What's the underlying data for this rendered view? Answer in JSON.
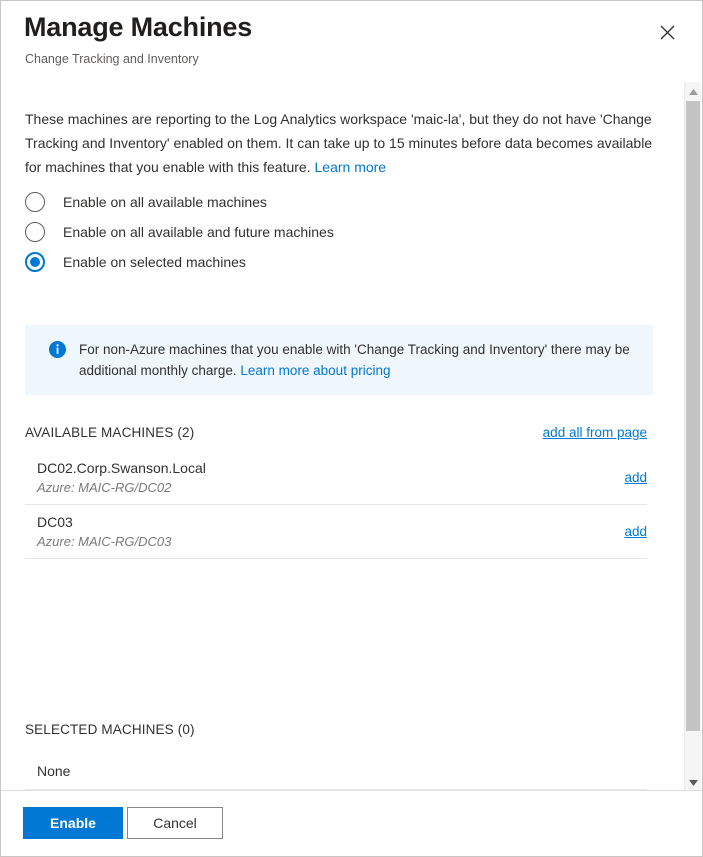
{
  "dialog": {
    "title": "Manage Machines",
    "subtitle": "Change Tracking and Inventory",
    "close_label": "Close"
  },
  "description": {
    "text": "These machines are reporting to the Log Analytics workspace 'maic-la', but they do not have 'Change Tracking and Inventory' enabled on them. It can take up to 15 minutes before data becomes available for machines that you enable with this feature.",
    "link_label": "Learn more"
  },
  "radio_options": [
    {
      "label": "Enable on all available machines",
      "selected": false
    },
    {
      "label": "Enable on all available and future machines",
      "selected": false
    },
    {
      "label": "Enable on selected machines",
      "selected": true
    }
  ],
  "info_banner": {
    "text": "For non-Azure machines that you enable with 'Change Tracking and Inventory' there may be additional monthly charge.",
    "link_label": "Learn more about pricing"
  },
  "available_section": {
    "title": "AVAILABLE MACHINES (2)",
    "action_label": "add all from page",
    "machines": [
      {
        "name": "DC02.Corp.Swanson.Local",
        "subtitle": "Azure: MAIC-RG/DC02",
        "action_label": "add"
      },
      {
        "name": "DC03",
        "subtitle": "Azure: MAIC-RG/DC03",
        "action_label": "add"
      }
    ]
  },
  "selected_section": {
    "title": "SELECTED MACHINES (0)",
    "empty_label": "None"
  },
  "footer": {
    "primary_label": "Enable",
    "secondary_label": "Cancel"
  },
  "colors": {
    "accent": "#0078d4",
    "info_background": "#eff6fc",
    "text": "#323130",
    "muted_text": "#605e5c"
  }
}
